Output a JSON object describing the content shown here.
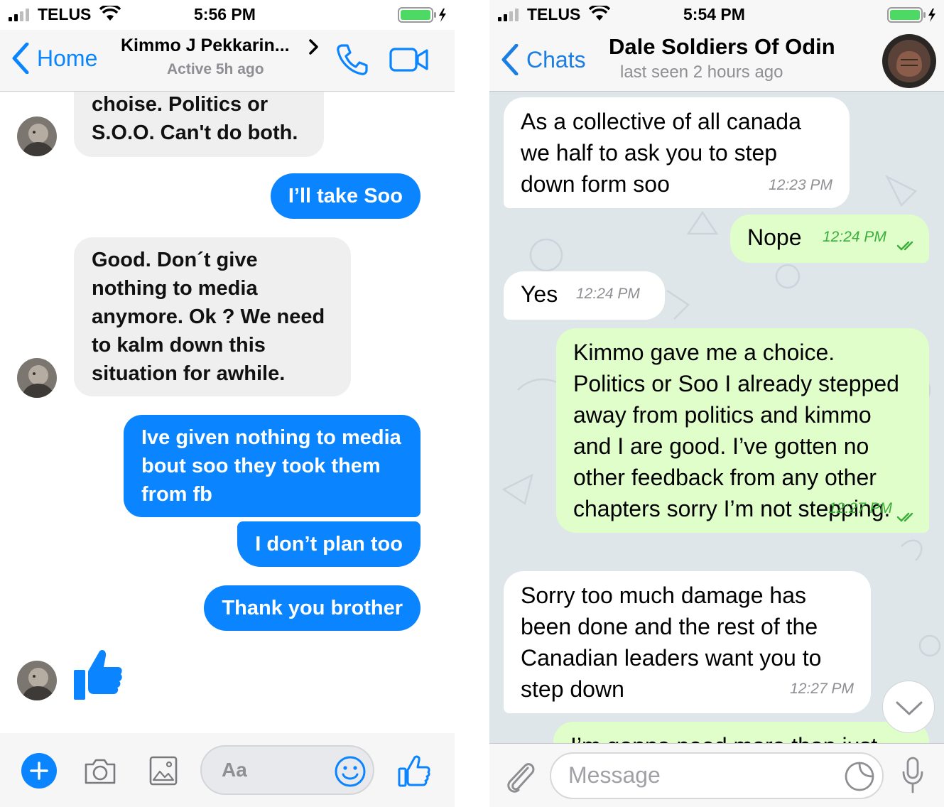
{
  "messenger": {
    "status": {
      "carrier": "TELUS",
      "time": "5:56 PM"
    },
    "header": {
      "back_label": "Home",
      "title": "Kimmo J Pekkarin...",
      "subtitle": "Active 5h ago"
    },
    "messages": [
      {
        "from": "contact",
        "text": "choise. Politics or S.O.O. Can't do both."
      },
      {
        "from": "me",
        "text": "I’ll take Soo"
      },
      {
        "from": "contact",
        "text": "Good. Don´t give nothing to media anymore. Ok ? We need to kalm down this situation for awhile."
      },
      {
        "from": "me",
        "text": "Ive given nothing to media bout soo they took them from fb"
      },
      {
        "from": "me",
        "text": "I don’t plan too"
      },
      {
        "from": "me",
        "text": "Thank you brother"
      },
      {
        "from": "contact",
        "sticker": "thumbs-up-icon"
      }
    ],
    "composer": {
      "placeholder": "Aa"
    },
    "accent_color": "#0a84ff"
  },
  "telegram": {
    "status": {
      "carrier": "TELUS",
      "time": "5:54 PM"
    },
    "header": {
      "back_label": "Chats",
      "title": "Dale Soldiers Of Odin",
      "subtitle": "last seen 2 hours ago"
    },
    "messages": [
      {
        "from": "contact",
        "text": "As a collective of all canada we half to ask you to step down form soo",
        "time": "12:23 PM"
      },
      {
        "from": "me",
        "text": "Nope",
        "time": "12:24 PM",
        "read": true
      },
      {
        "from": "contact",
        "text": "Yes",
        "time": "12:24 PM"
      },
      {
        "from": "me",
        "text": "Kimmo gave me a choice. Politics or Soo I already stepped away from politics and kimmo and I are good. I’ve gotten no other feedback from any other chapters sorry I’m not stepping.",
        "time": "12:27 PM",
        "read": true
      },
      {
        "from": "contact",
        "text": "Sorry too much damage has been done and the rest of the Canadian leaders want you to step down",
        "time": "12:27 PM"
      },
      {
        "from": "me",
        "text": "I’m gonna need more than just"
      }
    ],
    "composer": {
      "placeholder": "Message"
    },
    "accent_color": "#1b7ee2",
    "outgoing_bubble_color": "#e0feca"
  }
}
